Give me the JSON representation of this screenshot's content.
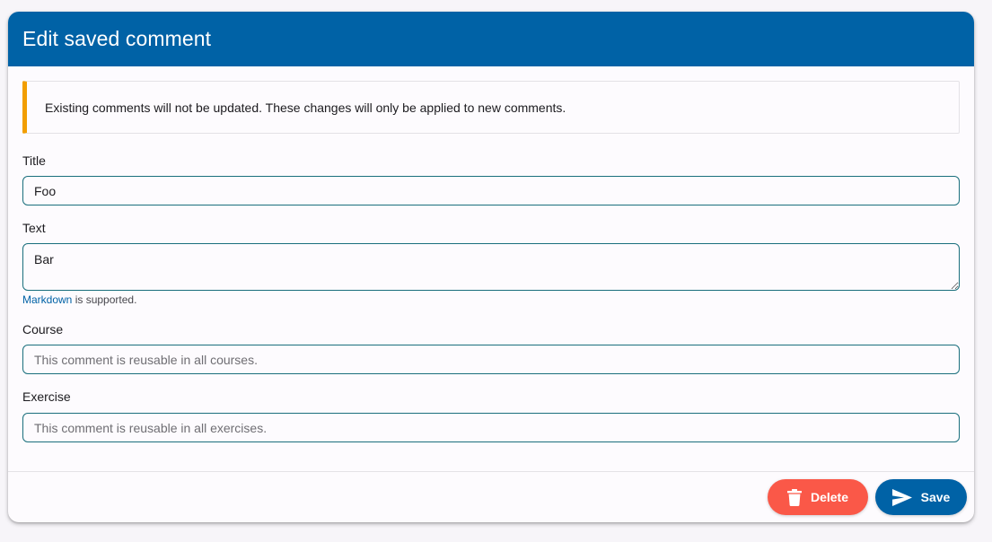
{
  "dialog": {
    "title": "Edit saved comment",
    "header_color": "#0062a6"
  },
  "alert": {
    "message": "Existing comments will not be updated. These changes will only be applied to new comments.",
    "accent_color": "#f29e00"
  },
  "form": {
    "title_label": "Title",
    "title_value": "Foo",
    "text_label": "Text",
    "text_value": "Bar",
    "markdown_link": "Markdown",
    "markdown_suffix": " is supported.",
    "course_label": "Course",
    "course_value": "",
    "course_placeholder": "This comment is reusable in all courses.",
    "exercise_label": "Exercise",
    "exercise_value": "",
    "exercise_placeholder": "This comment is reusable in all exercises."
  },
  "actions": {
    "delete_label": "Delete",
    "delete_icon": "trash-icon",
    "delete_color": "#fa5848",
    "save_label": "Save",
    "save_icon": "send-icon",
    "save_color": "#0062a6"
  }
}
